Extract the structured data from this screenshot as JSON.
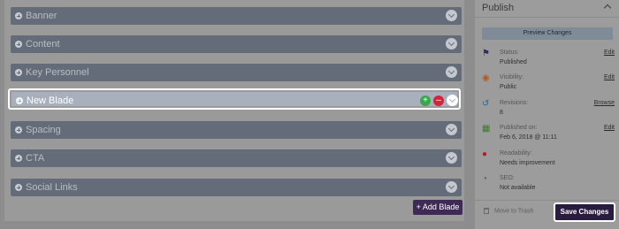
{
  "blades": [
    {
      "label": "Banner"
    },
    {
      "label": "Content"
    },
    {
      "label": "Key Personnel"
    },
    {
      "label": "New Blade"
    },
    {
      "label": "Spacing"
    },
    {
      "label": "CTA"
    },
    {
      "label": "Social Links"
    }
  ],
  "highlighted_blade": {
    "label": "New Blade",
    "add_icon": "+",
    "remove_icon": "–"
  },
  "add_blade_button": "+ Add Blade",
  "publish": {
    "title": "Publish",
    "preview_button": "Preview Changes",
    "rows": [
      {
        "key": "Status:",
        "value": "Published",
        "action": "Edit",
        "icon": "flag-icon",
        "color": "#2d2a6e"
      },
      {
        "key": "Visibility:",
        "value": "Public",
        "action": "Edit",
        "icon": "eye-icon",
        "color": "#b05a1e"
      },
      {
        "key": "Revisions:",
        "value": "8",
        "action": "Browse",
        "icon": "history-icon",
        "color": "#1a6ba0"
      },
      {
        "key": "Published on:",
        "value": "Feb 6, 2018 @ 11:11",
        "action": "Edit",
        "icon": "calendar-icon",
        "color": "#3c7a2a"
      },
      {
        "key": "Readability:",
        "value": "Needs improvement",
        "action": "",
        "icon": "alert-icon",
        "color": "#b01e1e"
      },
      {
        "key": "SEO:",
        "value": "Not available",
        "action": "",
        "icon": "gauge-icon",
        "color": "#555555"
      }
    ],
    "trash_label": "Move to Trash",
    "save_button": "Save Changes"
  }
}
